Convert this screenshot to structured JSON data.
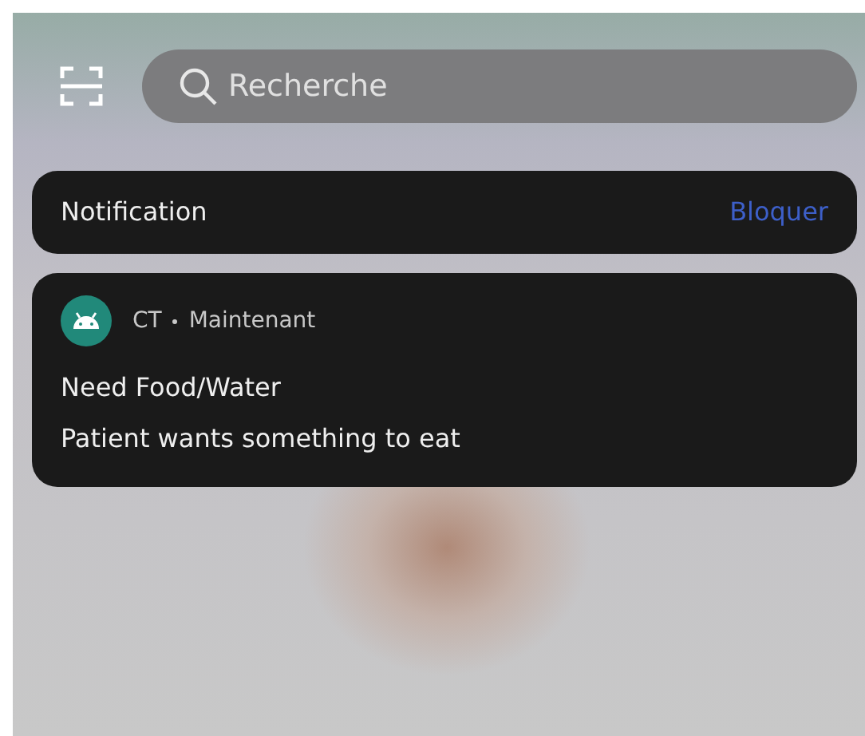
{
  "search": {
    "placeholder": "Recherche"
  },
  "notification_bar": {
    "label": "Notification",
    "action": "Bloquer"
  },
  "notifications": [
    {
      "app": "CT",
      "time": "Maintenant",
      "title": "Need Food/Water",
      "body": "Patient wants something to eat"
    }
  ]
}
